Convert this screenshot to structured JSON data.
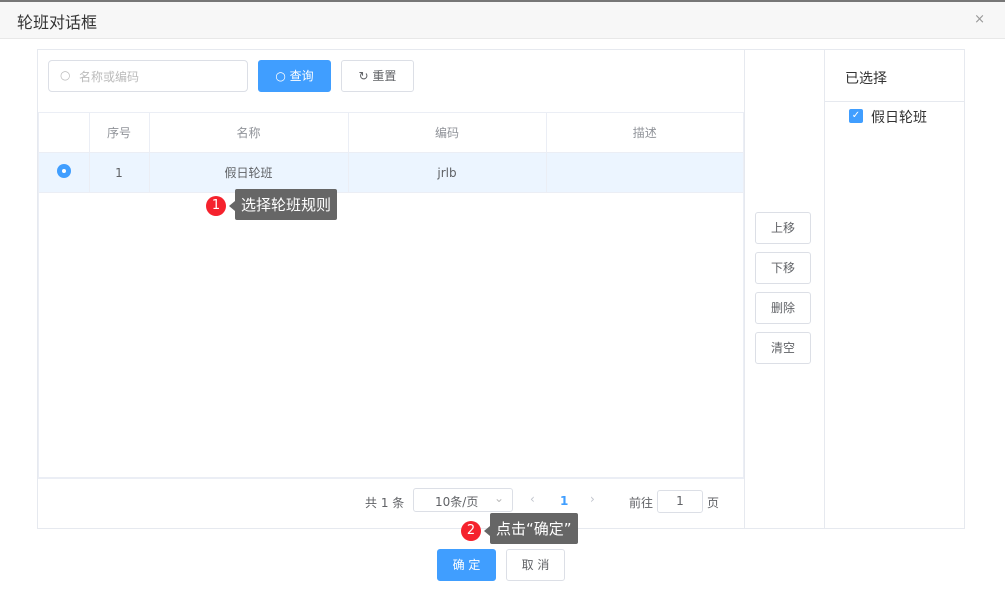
{
  "dialog": {
    "title": "轮班对话框",
    "close": "×"
  },
  "search": {
    "placeholder": "名称或编码",
    "query": "查询",
    "reset": "重置"
  },
  "table": {
    "headers": [
      "序号",
      "名称",
      "编码",
      "描述"
    ],
    "rows": [
      {
        "index": "1",
        "name": "假日轮班",
        "code": "jrlb",
        "desc": ""
      }
    ]
  },
  "pagination": {
    "total": "共 1 条",
    "page_size": "10条/页",
    "current": "1",
    "goto_label": "前往",
    "goto_value": "1",
    "page_suffix": "页"
  },
  "side_buttons": {
    "up": "上移",
    "down": "下移",
    "delete": "删除",
    "clear": "清空"
  },
  "selected": {
    "title": "已选择",
    "items": [
      "假日轮班"
    ]
  },
  "footer": {
    "ok": "确 定",
    "cancel": "取 消"
  },
  "annotations": [
    {
      "num": "1",
      "text": "选择轮班规则"
    },
    {
      "num": "2",
      "text": "点击“确定”"
    }
  ]
}
